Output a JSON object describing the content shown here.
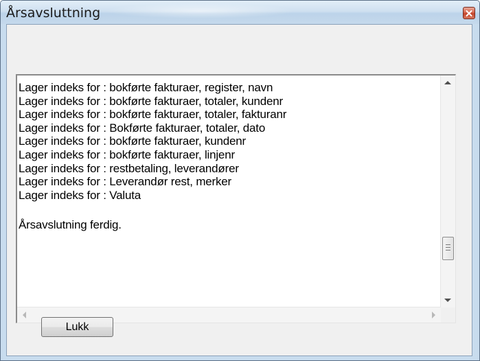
{
  "window": {
    "title": "Årsavsluttning"
  },
  "log": {
    "lines": [
      "Lager indeks for : bokførte fakturaer, register, navn",
      "Lager indeks for : bokførte fakturaer, totaler, kundenr",
      "Lager indeks for : bokførte fakturaer, totaler, fakturanr",
      "Lager indeks for : Bokførte fakturaer, totaler, dato",
      "Lager indeks for : bokførte fakturaer, kundenr",
      "Lager indeks for : bokførte fakturaer, linjenr",
      "Lager indeks for : restbetaling, leverandører",
      "Lager indeks for : Leverandør rest, merker",
      "Lager indeks for : Valuta"
    ],
    "final_message": "Årsavslutning ferdig."
  },
  "buttons": {
    "close_label": "Lukk"
  },
  "icons": {
    "close": "close-icon",
    "scroll_up": "scroll-up-arrow-icon",
    "scroll_down": "scroll-down-arrow-icon",
    "scroll_left": "scroll-left-arrow-icon",
    "scroll_right": "scroll-right-arrow-icon"
  },
  "colors": {
    "titlebar": "#cfe0f0",
    "close_button": "#c3442a",
    "client_bg": "#f0f0f0"
  }
}
